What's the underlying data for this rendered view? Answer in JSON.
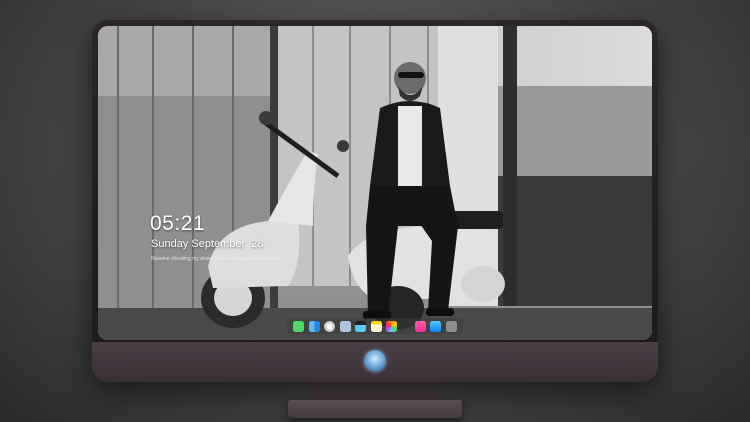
{
  "lock_screen": {
    "time": "05:21",
    "date": "Sunday September  28",
    "hint": "Resume checking my drives in the next steps in this screen"
  },
  "dock": {
    "items": [
      {
        "name": "messages-icon",
        "color": "#4cd964"
      },
      {
        "name": "finder-icon",
        "color": "#1e88e5"
      },
      {
        "name": "safari-icon",
        "color": "#e8e8e8"
      },
      {
        "name": "preview-icon",
        "color": "#b0c4de"
      },
      {
        "name": "claquette-icon",
        "color": "#5ac8fa"
      },
      {
        "name": "notes-icon",
        "color": "#ffd60a"
      },
      {
        "name": "photos-icon",
        "color": "#8bc34a"
      },
      {
        "name": "itunes-icon",
        "color": "#ff2d92"
      },
      {
        "name": "app-store-icon",
        "color": "#0a84ff"
      },
      {
        "name": "camera-icon",
        "color": "#8e8e93"
      }
    ]
  },
  "colors": {
    "monitor_bezel": "#1d1a1c",
    "monitor_chin": "#4b3f46",
    "wallpaper_tone": "grayscale"
  }
}
